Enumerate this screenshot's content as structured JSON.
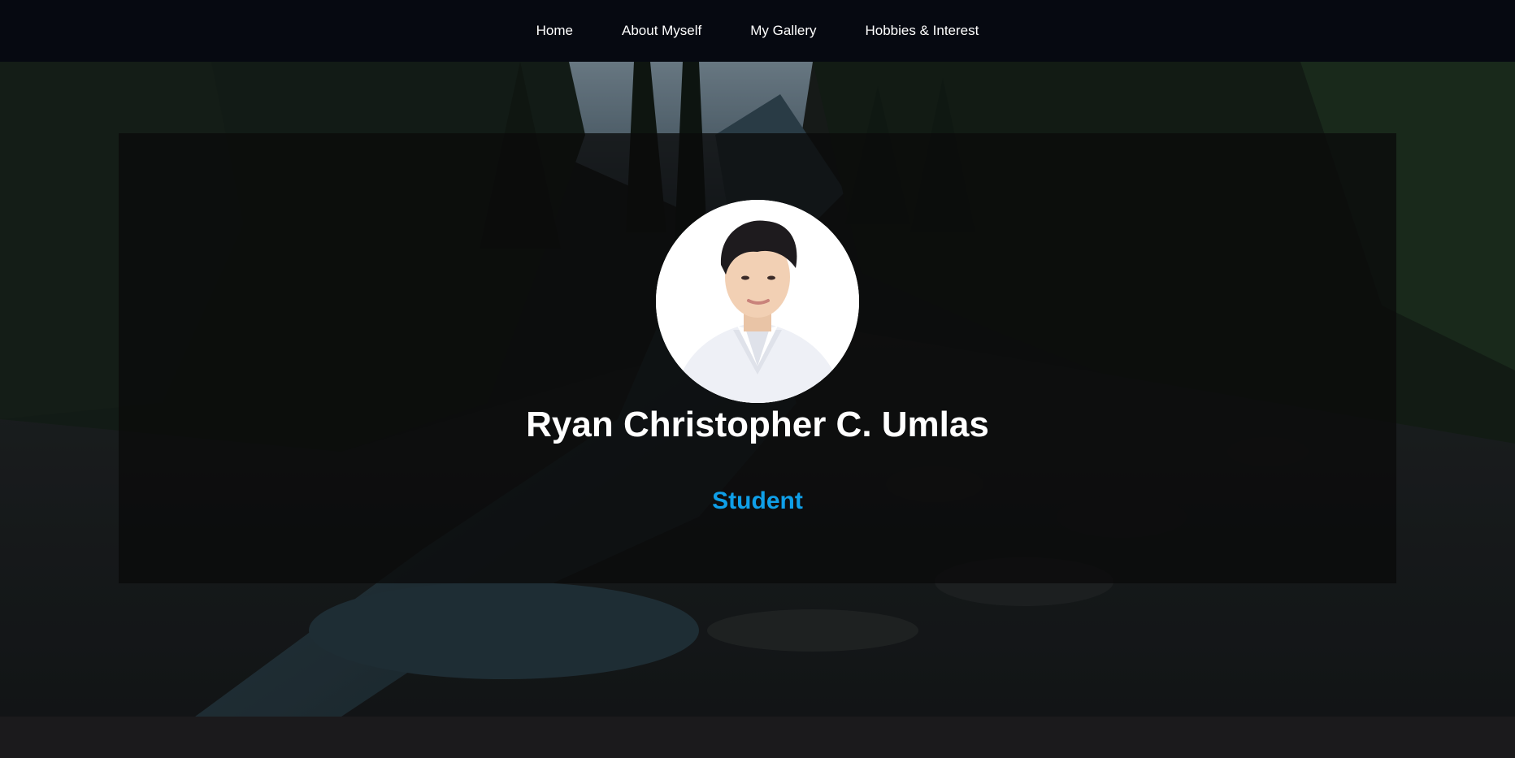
{
  "nav": {
    "items": [
      {
        "label": "Home"
      },
      {
        "label": "About Myself"
      },
      {
        "label": "My Gallery"
      },
      {
        "label": "Hobbies & Interest"
      }
    ]
  },
  "profile": {
    "name": "Ryan Christopher C. Umlas",
    "role": "Student",
    "avatar_icon": "profile-photo"
  },
  "colors": {
    "nav_bg": "#060911",
    "accent": "#0f9fe8",
    "page_bg": "#1b1a1c"
  }
}
